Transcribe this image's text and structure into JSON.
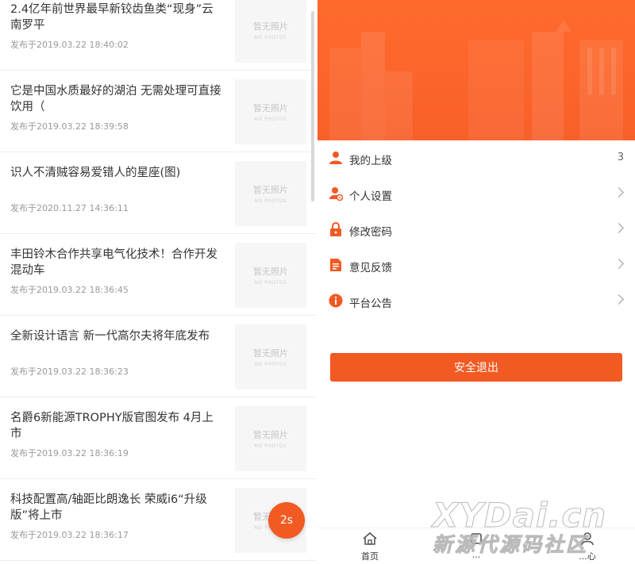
{
  "news": {
    "items": [
      {
        "title": "2.4亿年前世界最早新铰齿鱼类“现身”云南罗平",
        "time": "发布于2019.03.22 18:40:02"
      },
      {
        "title": "它是中国水质最好的湖泊 无需处理可直接饮用（",
        "time": "发布于2019.03.22 18:39:58"
      },
      {
        "title": "识人不清贼容易爱错人的星座(图)",
        "time": "发布于2020.11.27 14:36:11"
      },
      {
        "title": "丰田铃木合作共享电气化技术！合作开发混动车",
        "time": "发布于2019.03.22 18:36:45"
      },
      {
        "title": "全新设计语言 新一代高尔夫将年底发布",
        "time": "发布于2019.03.22 18:36:23"
      },
      {
        "title": "名爵6新能源TROPHY版官图发布 4月上市",
        "time": "发布于2019.03.22 18:36:19"
      },
      {
        "title": "科技配置高/轴距比朗逸长 荣威i6“升级版”将上市",
        "time": "发布于2019.03.22 18:36:17"
      }
    ],
    "thumb_text": "暂无照片",
    "thumb_subtext": "NO PHOTOS"
  },
  "timer": {
    "label": "2s",
    "color": "#f15a22"
  },
  "profile": {
    "accent": "#f15a22",
    "menu": [
      {
        "label": "我的上级",
        "value": "3",
        "icon": "user-icon"
      },
      {
        "label": "个人设置",
        "icon": "user-settings-icon"
      },
      {
        "label": "修改密码",
        "icon": "lock-icon"
      },
      {
        "label": "意见反馈",
        "icon": "feedback-document-icon"
      },
      {
        "label": "平台公告",
        "icon": "info-icon"
      }
    ],
    "logout_label": "安全退出"
  },
  "tabbar": {
    "tabs": [
      {
        "label": "首页",
        "icon": "home-icon"
      },
      {
        "label": "...",
        "icon": "tab-icon"
      },
      {
        "label": "...心",
        "icon": "user-center-icon"
      }
    ]
  },
  "watermark": {
    "line1": "XYDai.cn",
    "line2": "新源代源码社区"
  }
}
